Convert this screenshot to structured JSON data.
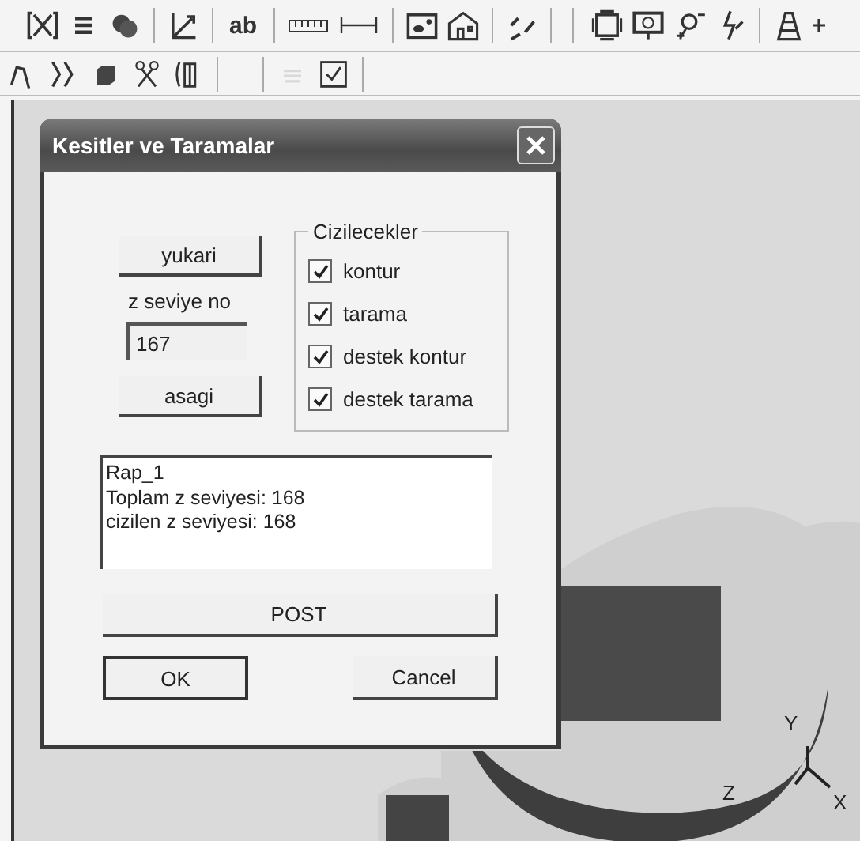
{
  "toolbar": {
    "text_button": "ab"
  },
  "dialog": {
    "title": "Kesitler ve Taramalar",
    "up_button": "yukari",
    "level_label": "z seviye no",
    "level_field": {
      "value": "167"
    },
    "down_button": "asagi",
    "group": {
      "title": "Cizilecekler",
      "options": [
        {
          "label": "kontur",
          "checked": true
        },
        {
          "label": "tarama",
          "checked": true
        },
        {
          "label": "destek kontur",
          "checked": true
        },
        {
          "label": "destek tarama",
          "checked": true
        }
      ]
    },
    "report": [
      "Rap_1",
      "Toplam z seviyesi:  168",
      "cizilen z seviyesi:  168"
    ],
    "post_button": "POST",
    "buttons": [
      {
        "label": "OK",
        "selected": true
      },
      {
        "label": "Cancel",
        "selected": false
      }
    ]
  },
  "viewport": {
    "axes": [
      "Y",
      "Z",
      "X"
    ]
  }
}
